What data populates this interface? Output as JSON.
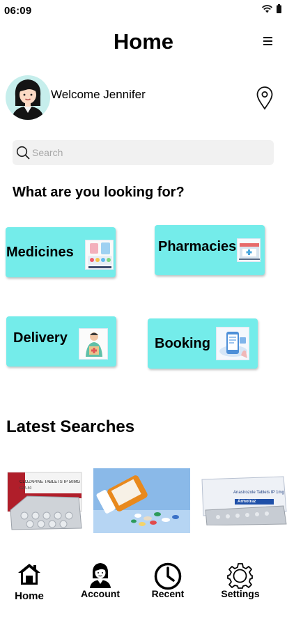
{
  "status_bar": {
    "time": "06:09"
  },
  "header": {
    "title": "Home"
  },
  "user": {
    "welcome": "Welcome Jennifer"
  },
  "search": {
    "placeholder": "Search"
  },
  "categories_heading": "What are you looking for?",
  "categories": [
    {
      "label": "Medicines",
      "image_icon": "pills-pharmacy-icon"
    },
    {
      "label": "Pharmacies",
      "image_icon": "pharmacy-store-icon"
    },
    {
      "label": "Delivery",
      "image_icon": "delivery-person-icon"
    },
    {
      "label": "Booking",
      "image_icon": "phone-booking-icon"
    }
  ],
  "latest_searches": {
    "heading": "Latest Searches",
    "items": [
      {
        "box_text": "CLOZAPINE TABLETS IP 50MG",
        "box_subtext": "CZA-50"
      },
      {
        "box_text": ""
      },
      {
        "box_text": "Anastrozole Tablets IP 1mg",
        "box_subtext": "Armotraz"
      }
    ]
  },
  "nav": [
    {
      "label": "Home",
      "icon": "home-icon",
      "active": true
    },
    {
      "label": "Account",
      "icon": "account-icon",
      "active": false
    },
    {
      "label": "Recent",
      "icon": "clock-icon",
      "active": false
    },
    {
      "label": "Settings",
      "icon": "gear-icon",
      "active": false
    }
  ],
  "colors": {
    "card": "#74ecea",
    "avatar_bg": "#c6eeec",
    "search_bg": "#f1f1f1"
  }
}
